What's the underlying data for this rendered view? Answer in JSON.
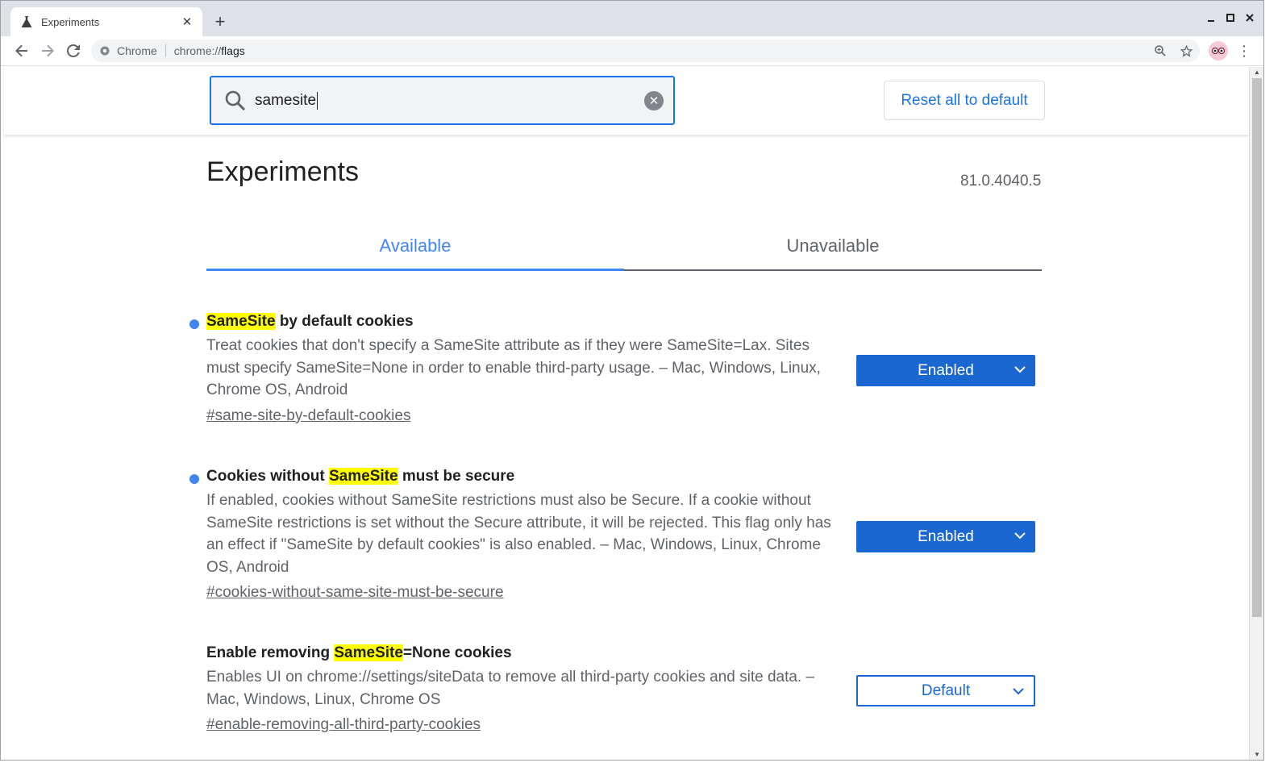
{
  "browser": {
    "tab_title": "Experiments",
    "new_tab_symbol": "+",
    "omnibox_chip": "Chrome",
    "url_scheme": "chrome://",
    "url_path": "flags",
    "window_controls": [
      "minimize-icon",
      "maximize-icon",
      "close-icon"
    ]
  },
  "search": {
    "value": "samesite",
    "clear_symbol": "✕"
  },
  "reset_label": "Reset all to default",
  "page_title": "Experiments",
  "version": "81.0.4040.5",
  "tabs": [
    {
      "label": "Available",
      "active": true
    },
    {
      "label": "Unavailable",
      "active": false
    }
  ],
  "flags": [
    {
      "title_pre": "",
      "title_highlight": "SameSite",
      "title_post": " by default cookies",
      "modified": true,
      "description": "Treat cookies that don't specify a SameSite attribute as if they were SameSite=Lax. Sites must specify SameSite=None in order to enable third-party usage. – Mac, Windows, Linux, Chrome OS, Android",
      "anchor": "#same-site-by-default-cookies",
      "selected": "Enabled"
    },
    {
      "title_pre": "Cookies without ",
      "title_highlight": "SameSite",
      "title_post": " must be secure",
      "modified": true,
      "description": "If enabled, cookies without SameSite restrictions must also be Secure. If a cookie without SameSite restrictions is set without the Secure attribute, it will be rejected. This flag only has an effect if \"SameSite by default cookies\" is also enabled. – Mac, Windows, Linux, Chrome OS, Android",
      "anchor": "#cookies-without-same-site-must-be-secure",
      "selected": "Enabled"
    },
    {
      "title_pre": "Enable removing ",
      "title_highlight": "SameSite",
      "title_post": "=None cookies",
      "modified": false,
      "description": "Enables UI on chrome://settings/siteData to remove all third-party cookies and site data. – Mac, Windows, Linux, Chrome OS",
      "anchor": "#enable-removing-all-third-party-cookies",
      "selected": "Default"
    }
  ],
  "colors": {
    "accent": "#1a73e8",
    "tab_active": "#4285f4",
    "select_enabled_bg": "#1a67d2",
    "highlight": "#ffff00",
    "modified_dot": "#4285f4"
  }
}
